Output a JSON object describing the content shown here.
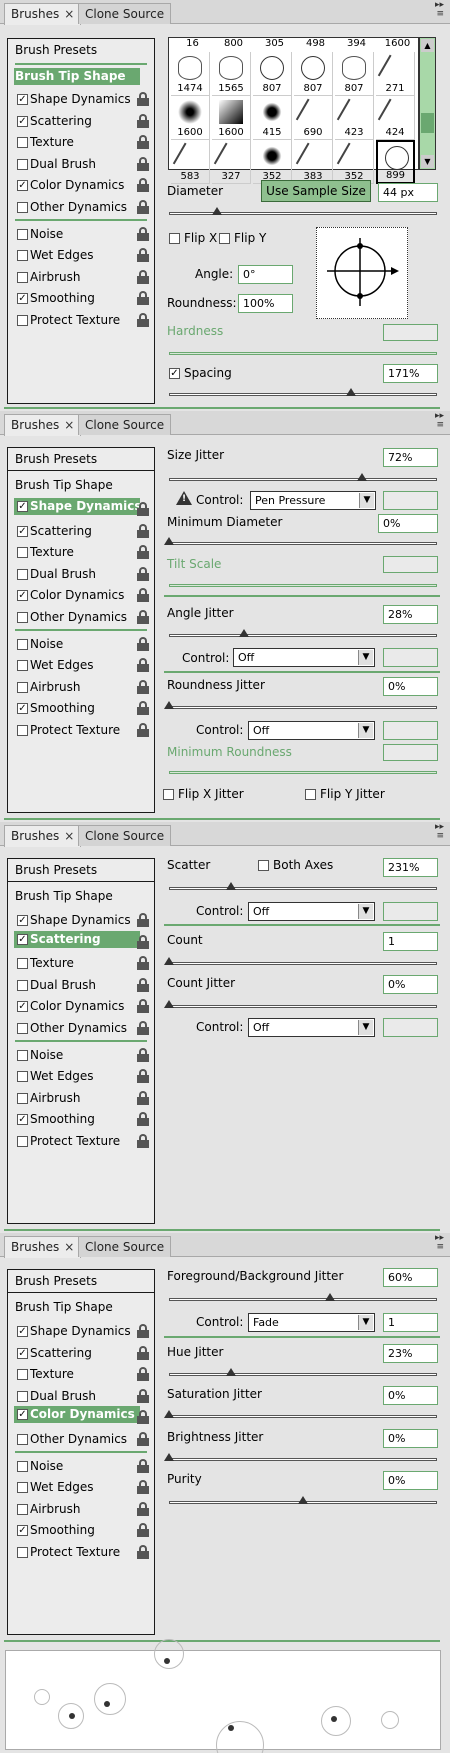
{
  "tabs": {
    "brushes": "Brushes",
    "clone_source": "Clone Source",
    "close": "×"
  },
  "sidebar": {
    "presets": "Brush Presets",
    "tip_shape": "Brush Tip Shape",
    "items": [
      "Shape Dynamics",
      "Scattering",
      "Texture",
      "Dual Brush",
      "Color Dynamics",
      "Other Dynamics",
      "Noise",
      "Wet Edges",
      "Airbrush",
      "Smoothing",
      "Protect Texture"
    ],
    "checked": [
      true,
      true,
      false,
      false,
      true,
      false,
      false,
      false,
      false,
      true,
      false
    ]
  },
  "tip_shape": {
    "top_numbers": [
      "16",
      "800",
      "305",
      "498",
      "394",
      "1600"
    ],
    "brush_numbers": [
      "1474",
      "1565",
      "807",
      "807",
      "807",
      "271",
      "1600",
      "1600",
      "415",
      "690",
      "423",
      "424",
      "583",
      "327",
      "352",
      "383",
      "352",
      "899"
    ],
    "diameter_label": "Diameter",
    "use_sample_size": "Use Sample Size",
    "diameter_value": "44 px",
    "diameter_slider": 0.18,
    "flip_x": "Flip X",
    "flip_y": "Flip Y",
    "angle_label": "Angle:",
    "angle_value": "0°",
    "roundness_label": "Roundness:",
    "roundness_value": "100%",
    "hardness_label": "Hardness",
    "spacing_label": "Spacing",
    "spacing_value": "171%",
    "spacing_slider": 0.68
  },
  "shape_dynamics": {
    "size_jitter": "Size Jitter",
    "size_jitter_value": "72%",
    "size_jitter_slider": 0.72,
    "control": "Control:",
    "control_value": "Pen Pressure",
    "min_diameter": "Minimum Diameter",
    "min_diameter_value": "0%",
    "tilt_scale": "Tilt Scale",
    "angle_jitter": "Angle Jitter",
    "angle_jitter_value": "28%",
    "angle_jitter_slider": 0.28,
    "angle_control": "Off",
    "roundness_jitter": "Roundness Jitter",
    "roundness_jitter_value": "0%",
    "roundness_control": "Off",
    "min_roundness": "Minimum Roundness",
    "flip_x_jitter": "Flip X Jitter",
    "flip_y_jitter": "Flip Y Jitter"
  },
  "scattering": {
    "scatter": "Scatter",
    "both_axes": "Both Axes",
    "scatter_value": "231%",
    "scatter_slider": 0.23,
    "control_value": "Off",
    "count": "Count",
    "count_value": "1",
    "count_jitter": "Count Jitter",
    "count_jitter_value": "0%",
    "count_control": "Off"
  },
  "color_dynamics": {
    "fg_bg_jitter": "Foreground/Background Jitter",
    "fg_bg_value": "60%",
    "fg_bg_slider": 0.6,
    "control_value": "Fade",
    "fade_value": "1",
    "hue_jitter": "Hue Jitter",
    "hue_value": "23%",
    "hue_slider": 0.23,
    "saturation_jitter": "Saturation Jitter",
    "saturation_value": "0%",
    "brightness_jitter": "Brightness Jitter",
    "brightness_value": "0%",
    "purity": "Purity",
    "purity_value": "0%",
    "purity_slider": 0.5
  },
  "colors": {
    "accent": "#6aa870",
    "border": "#1a1a1a"
  }
}
